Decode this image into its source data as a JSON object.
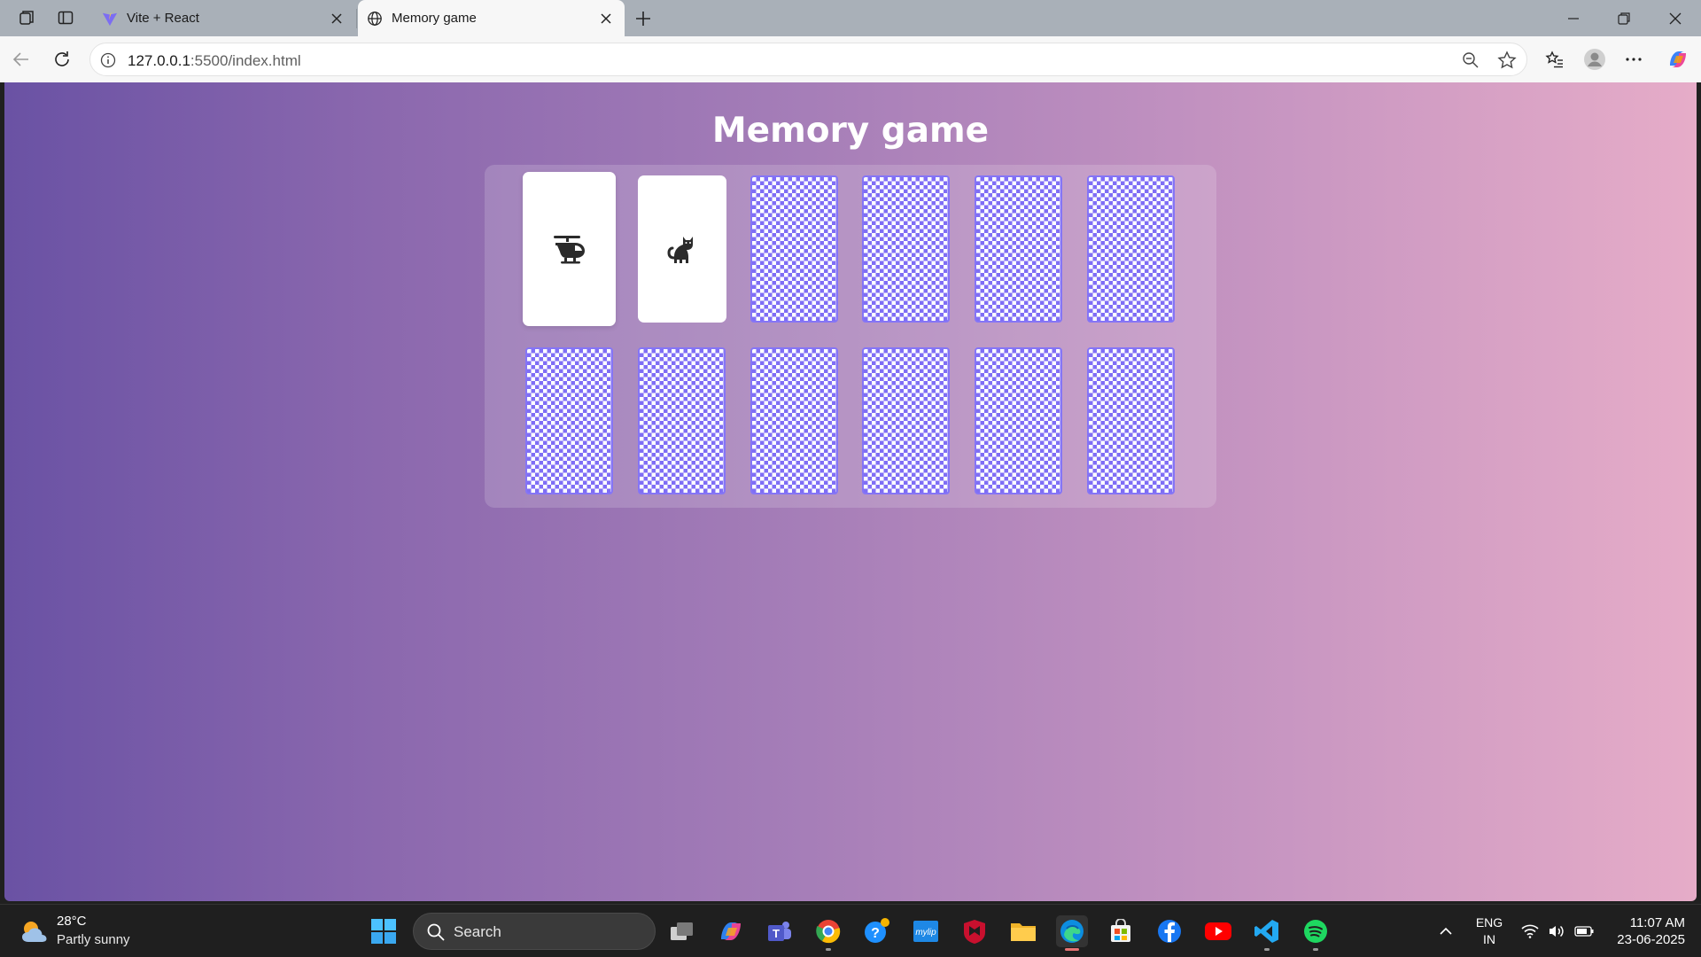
{
  "browser": {
    "tabs": [
      {
        "title": "Vite + React",
        "active": false
      },
      {
        "title": "Memory game",
        "active": true
      }
    ],
    "url_host": "127.0.0.1",
    "url_rest": ":5500/index.html"
  },
  "game": {
    "title": "Memory game",
    "cards": [
      {
        "state": "face-up",
        "icon": "helicopter-icon"
      },
      {
        "state": "face-up",
        "icon": "cat-icon"
      },
      {
        "state": "face-down"
      },
      {
        "state": "face-down"
      },
      {
        "state": "face-down"
      },
      {
        "state": "face-down"
      },
      {
        "state": "face-down"
      },
      {
        "state": "face-down"
      },
      {
        "state": "face-down"
      },
      {
        "state": "face-down"
      },
      {
        "state": "face-down"
      },
      {
        "state": "face-down"
      }
    ],
    "colors": {
      "gradient_start": "#6a52a4",
      "gradient_end": "#e6acc8",
      "card_pattern": "#7f6ef5"
    }
  },
  "taskbar": {
    "weather_temp": "28°C",
    "weather_desc": "Partly sunny",
    "search_placeholder": "Search",
    "lang_line1": "ENG",
    "lang_line2": "IN",
    "time": "11:07 AM",
    "date": "23-06-2025",
    "apps": [
      "file-explorer-icon",
      "copilot-icon",
      "teams-icon",
      "chrome-icon",
      "help-icon",
      "mylip-icon",
      "mcafee-icon",
      "folder-icon",
      "edge-icon",
      "store-icon",
      "facebook-icon",
      "youtube-icon",
      "vscode-icon",
      "spotify-icon"
    ]
  }
}
